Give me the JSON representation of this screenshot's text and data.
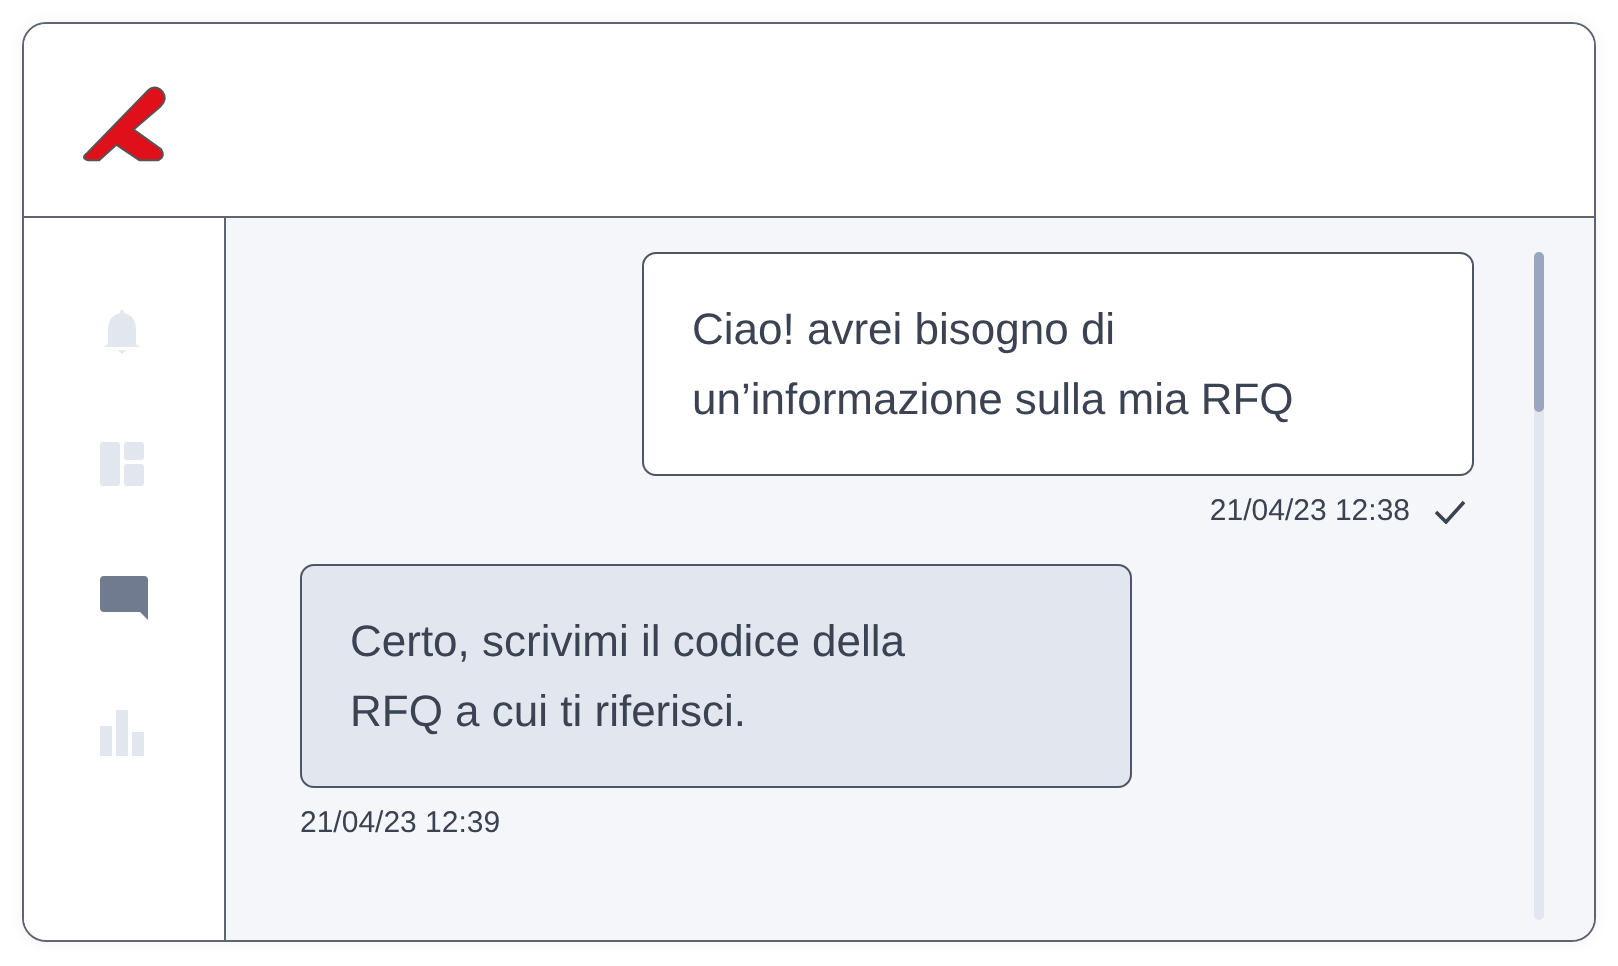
{
  "sidebar": {
    "items": [
      {
        "kind": "bell",
        "selected": false
      },
      {
        "kind": "dashboard",
        "selected": false
      },
      {
        "kind": "chat",
        "selected": true
      },
      {
        "kind": "chart",
        "selected": false
      }
    ]
  },
  "messages": [
    {
      "kind": "sent",
      "text": "Ciao! avrei bisogno di un’informazione sulla mia RFQ",
      "time": "21/04/23 12:38",
      "read": true
    },
    {
      "kind": "received",
      "text": "Certo, scrivimi il codice della RFQ a cui ti riferisci.",
      "time": "21/04/23 12:39",
      "read": false
    }
  ]
}
